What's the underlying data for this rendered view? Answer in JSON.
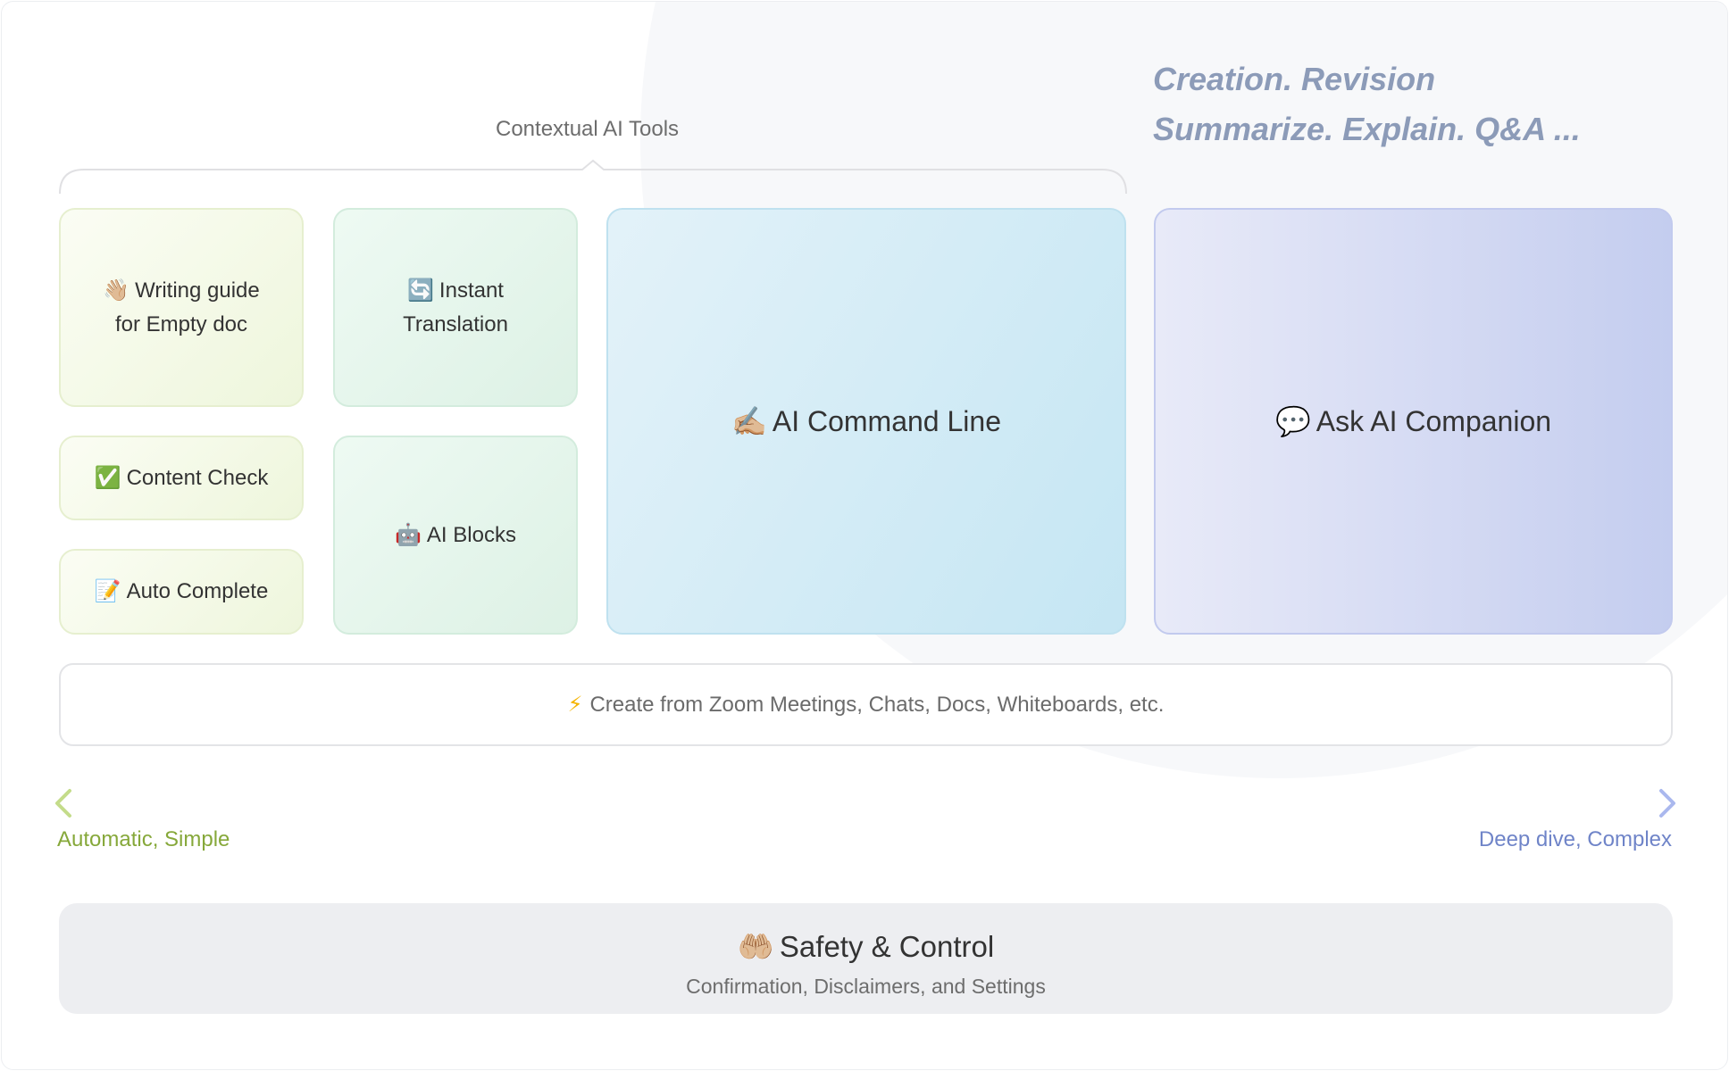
{
  "tagline": {
    "line1": "Creation. Revision",
    "line2": "Summarize. Explain. Q&A ..."
  },
  "contextual": {
    "title": "Contextual AI Tools"
  },
  "cards": {
    "writing_guide": {
      "emoji": "👋🏼",
      "line1": "Writing guide",
      "line2": "for Empty doc"
    },
    "instant_translation": {
      "emoji": "🔄",
      "line1": "Instant",
      "line2": "Translation"
    },
    "content_check": {
      "emoji": "✅",
      "label": "Content Check"
    },
    "auto_complete": {
      "emoji": "📝",
      "label": "Auto Complete"
    },
    "ai_blocks": {
      "emoji": "🤖",
      "label": "AI Blocks"
    },
    "ai_command_line": {
      "emoji": "✍🏼",
      "label": "AI Command Line"
    },
    "ask_ai_companion": {
      "emoji": "💬",
      "label": "Ask AI Companion"
    }
  },
  "banner": {
    "icon": "⚡",
    "text": "Create from Zoom Meetings, Chats, Docs, Whiteboards, etc."
  },
  "axis": {
    "left_label": "Automatic, Simple",
    "right_label": "Deep dive, Complex",
    "left_color": "#c4dc8a",
    "right_color": "#aab8ee"
  },
  "safety": {
    "emoji": "🤲🏼",
    "title": "Safety & Control",
    "subtitle": "Confirmation, Disclaimers, and Settings"
  },
  "colors": {
    "green_card": "#eef6dc",
    "teal_card": "#ddf1e5",
    "blue_card": "#c5e6f3",
    "violet_card": "#c4cdef",
    "tagline": "#8c9bb8"
  }
}
